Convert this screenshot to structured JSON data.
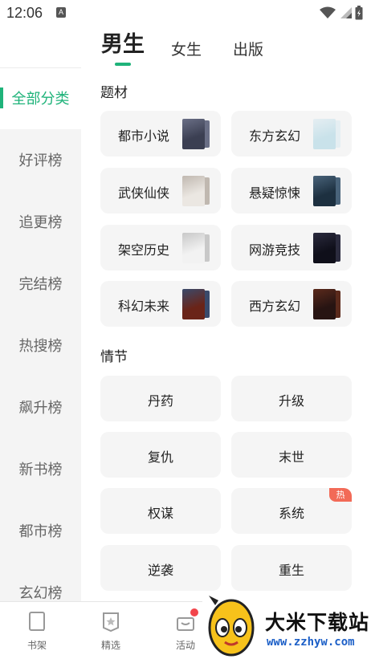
{
  "status_bar": {
    "time": "12:06",
    "notif_letter": "A"
  },
  "gender_tabs": [
    "男生",
    "女生",
    "出版"
  ],
  "sidebar": {
    "items": [
      "全部分类",
      "好评榜",
      "追更榜",
      "完结榜",
      "热搜榜",
      "飙升榜",
      "新书榜",
      "都市榜",
      "玄幻榜"
    ]
  },
  "sections": {
    "genre_title": "题材",
    "genres": [
      {
        "label": "都市小说",
        "cover": "#3b3f52",
        "back": "#6a6f86"
      },
      {
        "label": "东方玄幻",
        "cover": "#c9e2ea",
        "back": "#e5eef2"
      },
      {
        "label": "武侠仙侠",
        "cover": "#ebe7e2",
        "back": "#c0b8b0"
      },
      {
        "label": "悬疑惊悚",
        "cover": "#1d3040",
        "back": "#49637a"
      },
      {
        "label": "架空历史",
        "cover": "#f2f2f2",
        "back": "#c8c8c8"
      },
      {
        "label": "网游竞技",
        "cover": "#0f0f1a",
        "back": "#2b2b3e"
      },
      {
        "label": "科幻未来",
        "cover": "#6a2418",
        "back": "#3a4a6b"
      },
      {
        "label": "西方玄幻",
        "cover": "#271412",
        "back": "#5b2a1c"
      }
    ],
    "plot_title": "情节",
    "plots": [
      {
        "label": "丹药"
      },
      {
        "label": "升级"
      },
      {
        "label": "复仇"
      },
      {
        "label": "末世"
      },
      {
        "label": "权谋"
      },
      {
        "label": "系统",
        "badge": "热"
      },
      {
        "label": "逆袭"
      },
      {
        "label": "重生"
      }
    ]
  },
  "bottom_nav": {
    "items": [
      "书架",
      "精选",
      "活动"
    ]
  },
  "watermark": {
    "title": "大米下载站",
    "url": "www.zzhyw.com"
  },
  "colors": {
    "accent": "#1fb37a",
    "card_bg": "#f5f5f5",
    "sidebar_bg": "#f4f4f4",
    "hot": "#f26a57"
  }
}
